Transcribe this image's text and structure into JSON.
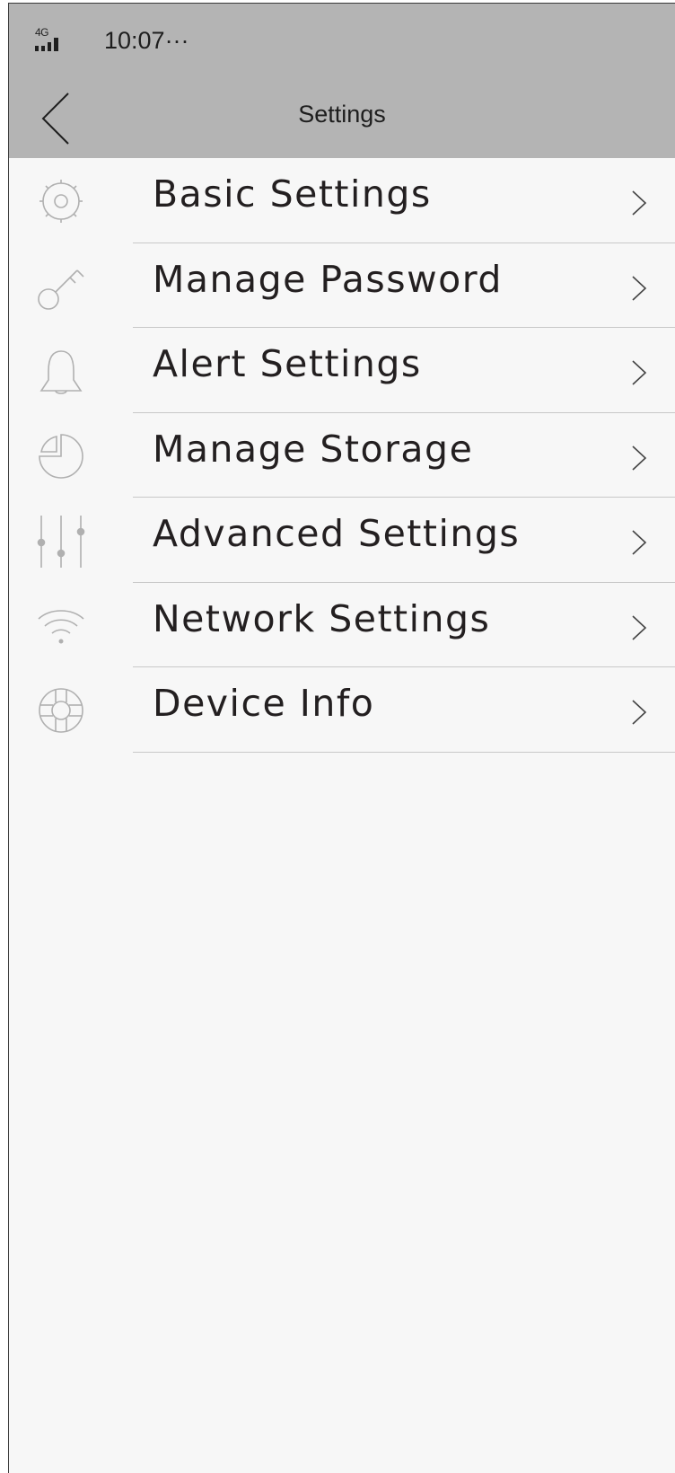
{
  "status_bar": {
    "network": "4G",
    "time": "10:07···"
  },
  "header": {
    "title": "Settings",
    "back_icon": "chevron-left-icon",
    "background": "#b4b4b4"
  },
  "menu": {
    "items": [
      {
        "label": "Basic Settings",
        "icon": "gear-icon"
      },
      {
        "label": "Manage Password",
        "icon": "key-icon"
      },
      {
        "label": "Alert Settings",
        "icon": "bell-icon"
      },
      {
        "label": "Manage Storage",
        "icon": "pie-chart-icon"
      },
      {
        "label": "Advanced Settings",
        "icon": "sliders-icon"
      },
      {
        "label": "Network Settings",
        "icon": "wifi-icon"
      },
      {
        "label": "Device Info",
        "icon": "lifebuoy-icon"
      }
    ]
  },
  "colors": {
    "background": "#f7f7f7",
    "text": "#231f20",
    "icon": "#b0b0b0",
    "divider": "#c8c8c8"
  }
}
